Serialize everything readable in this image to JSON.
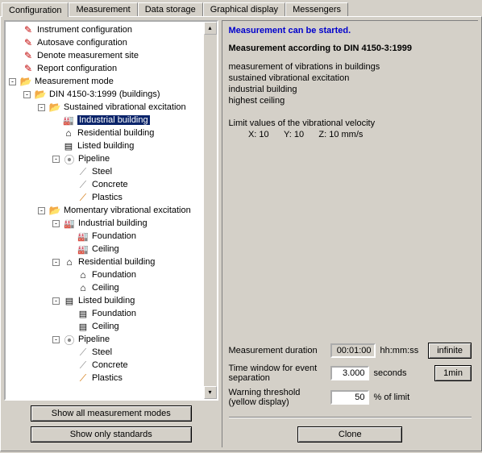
{
  "tabs": {
    "t0": "Configuration",
    "t1": "Measurement",
    "t2": "Data storage",
    "t3": "Graphical display",
    "t4": "Messengers"
  },
  "tree": {
    "n0": "Instrument configuration",
    "n1": "Autosave configuration",
    "n2": "Denote measurement site",
    "n3": "Report configuration",
    "n4": "Measurement mode",
    "n5": "DIN 4150-3:1999 (buildings)",
    "n6": "Sustained vibrational excitation",
    "n7": "Industrial building",
    "n8": "Residential building",
    "n9": "Listed building",
    "n10": "Pipeline",
    "n11": "Steel",
    "n12": "Concrete",
    "n13": "Plastics",
    "n14": "Momentary vibrational excitation",
    "n15": "Industrial building",
    "n16": "Foundation",
    "n17": "Ceiling",
    "n18": "Residential building",
    "n19": "Foundation",
    "n20": "Ceiling",
    "n21": "Listed building",
    "n22": "Foundation",
    "n23": "Ceiling",
    "n24": "Pipeline",
    "n25": "Steel",
    "n26": "Concrete",
    "n27": "Plastics"
  },
  "buttons": {
    "show_all": "Show all measurement modes",
    "show_std": "Show only standards",
    "infinite": "infinite",
    "onemin": "1min",
    "clone": "Clone"
  },
  "right": {
    "status": "Measurement can be started.",
    "title": "Measurement according to DIN 4150-3:1999",
    "line1": "measurement of vibrations in buildings",
    "line2": "sustained vibrational excitation",
    "line3": "industrial building",
    "line4": "highest ceiling",
    "limit_label": "Limit values of the vibrational velocity",
    "limit_vals": "        X: 10      Y: 10      Z: 10 mm/s",
    "dur_label": "Measurement duration",
    "dur_value": "00:01:00",
    "dur_unit": "hh:mm:ss",
    "win_label": "Time window for event separation",
    "win_value": "3.000",
    "win_unit": "seconds",
    "warn_label": "Warning threshold (yellow display)",
    "warn_value": "50",
    "warn_unit": "% of limit"
  }
}
